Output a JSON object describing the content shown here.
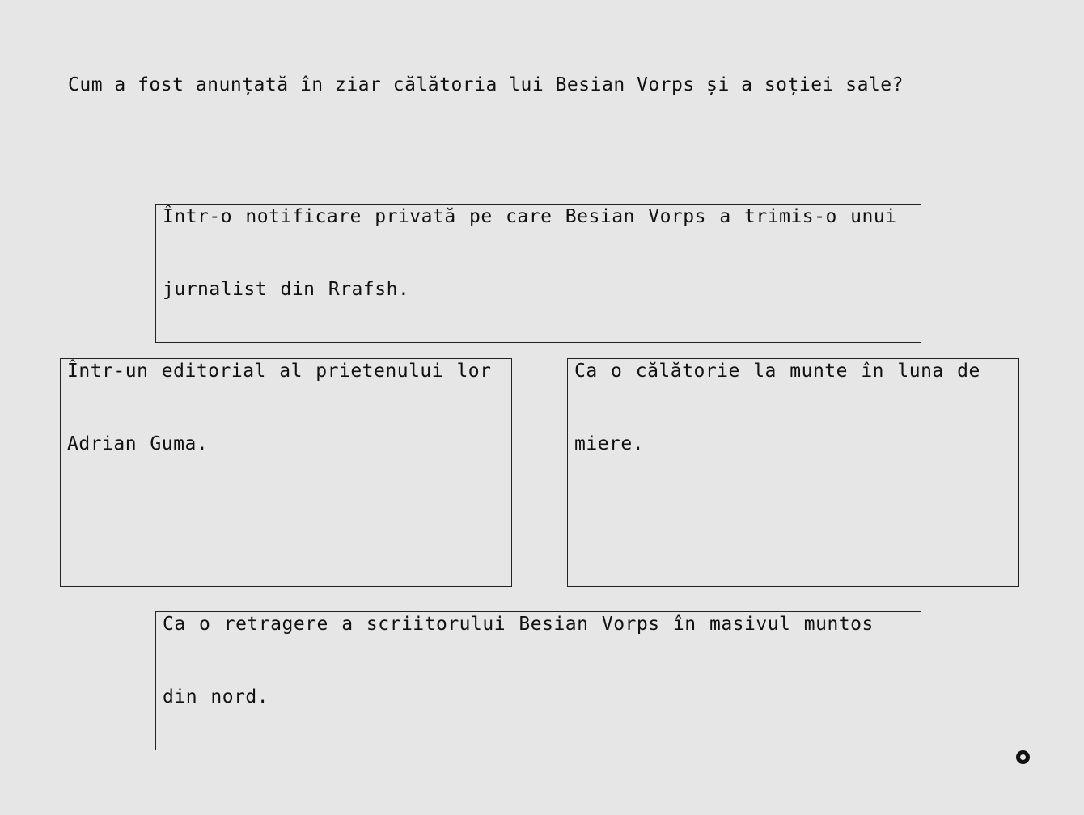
{
  "question": {
    "text": "Cum a fost anunțată în ziar călătoria lui Besian Vorps și a soției sale?"
  },
  "options": [
    {
      "id": "a",
      "text": "Într-o notificare privată pe care Besian Vorps a trimis-o unui jurnalist din Rrafsh."
    },
    {
      "id": "b",
      "text": "Într-un editorial al prietenului lor Adrian Guma."
    },
    {
      "id": "c",
      "text": "Ca o călătorie la munte în luna de miere."
    },
    {
      "id": "d",
      "text": "Ca o retragere a scriitorului Besian Vorps în masivul muntos din nord."
    }
  ],
  "indicator": {
    "icon": "record-circle-icon",
    "color": "#111111"
  }
}
